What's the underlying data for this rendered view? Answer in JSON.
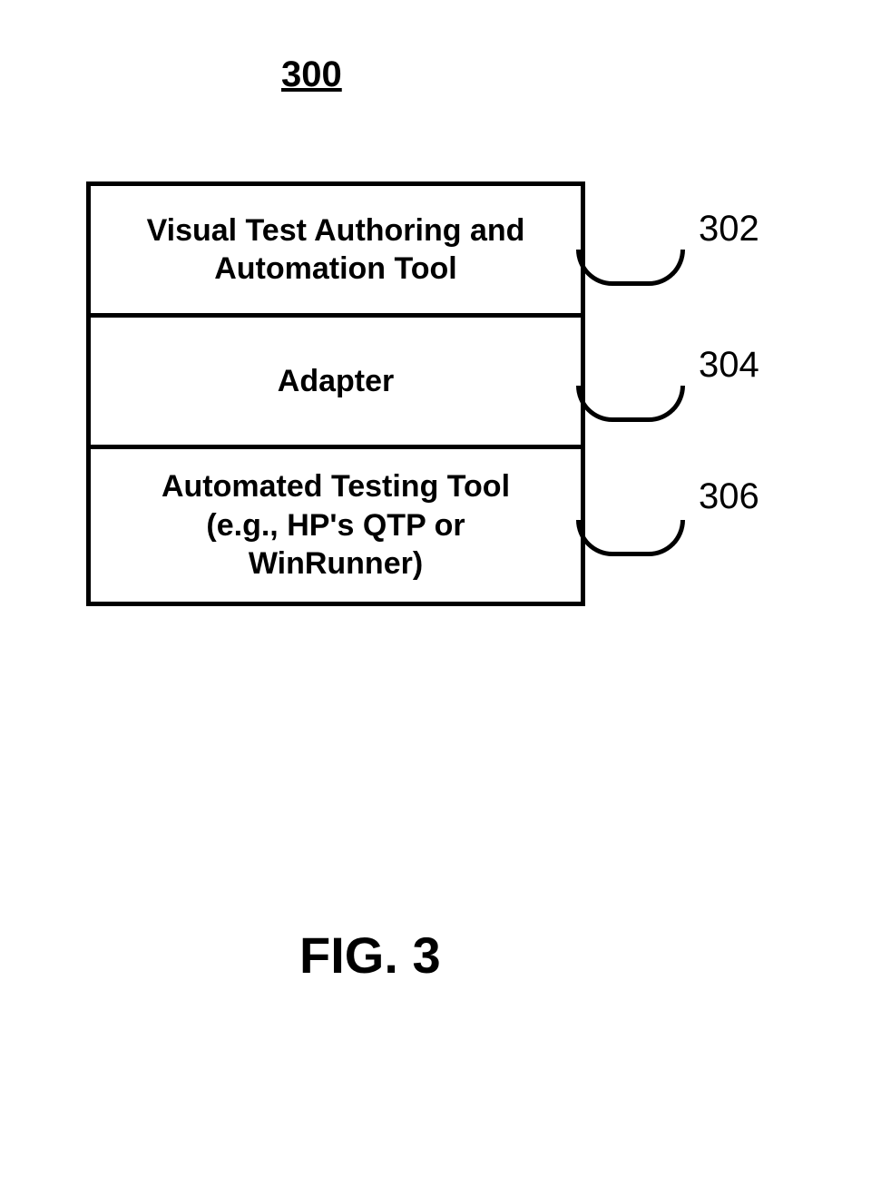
{
  "figure_number": "300",
  "boxes": {
    "b1": {
      "line1": "Visual Test Authoring and",
      "line2": "Automation Tool",
      "ref": "302"
    },
    "b2": {
      "line1": "Adapter",
      "ref": "304"
    },
    "b3": {
      "line1": "Automated Testing Tool",
      "line2": "(e.g., HP's QTP or",
      "line3": "WinRunner)",
      "ref": "306"
    }
  },
  "caption": "FIG. 3"
}
